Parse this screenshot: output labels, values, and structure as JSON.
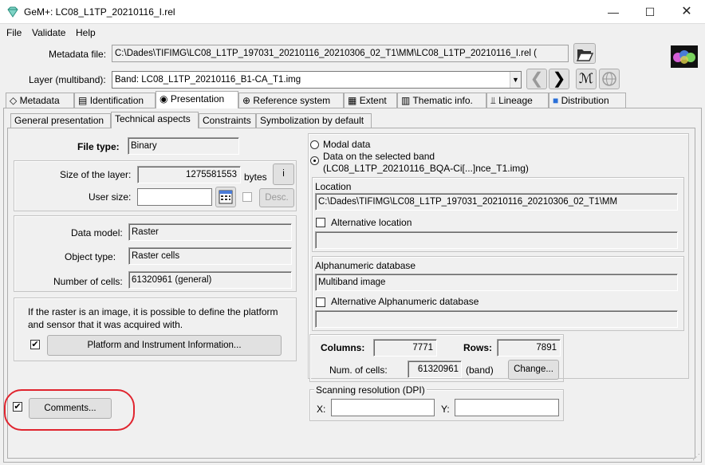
{
  "window": {
    "title": "GeM+: LC08_L1TP_20210116_I.rel",
    "controls": [
      "minimize",
      "maximize",
      "close"
    ]
  },
  "menu": [
    "File",
    "Validate",
    "Help"
  ],
  "header": {
    "metadata_label": "Metadata file:",
    "metadata_value": "C:\\Dades\\TIFIMG\\LC08_L1TP_197031_20210116_20210306_02_T1\\MM\\LC08_L1TP_20210116_I.rel (",
    "layer_label": "Layer (multiband):",
    "layer_value": "Band: LC08_L1TP_20210116_B1-CA_T1.img"
  },
  "tabs": [
    {
      "label": "Metadata",
      "icon": "tag-icon"
    },
    {
      "label": "Identification",
      "icon": "id-card-icon"
    },
    {
      "label": "Presentation",
      "icon": "eye-icon",
      "active": true
    },
    {
      "label": "Reference system",
      "icon": "globe-icon"
    },
    {
      "label": "Extent",
      "icon": "map-icon"
    },
    {
      "label": "Thematic info.",
      "icon": "table-icon"
    },
    {
      "label": "Lineage",
      "icon": "tree-icon"
    },
    {
      "label": "Distribution",
      "icon": "truck-icon"
    }
  ],
  "subtabs": [
    {
      "label": "General presentation"
    },
    {
      "label": "Technical aspects",
      "active": true
    },
    {
      "label": "Constraints"
    },
    {
      "label": "Symbolization by default"
    }
  ],
  "left": {
    "file_type_label": "File type:",
    "file_type_value": "Binary",
    "size_label": "Size of the layer:",
    "size_value": "1275581553",
    "size_unit": "bytes",
    "info_button": "i",
    "user_size_label": "User size:",
    "user_size_value": "",
    "desc_button": "Desc.",
    "data_model_label": "Data model:",
    "data_model_value": "Raster",
    "object_type_label": "Object type:",
    "object_type_value": "Raster cells",
    "num_cells_label": "Number of cells:",
    "num_cells_value": "61320961 (general)",
    "platform_text": "If the raster is an image, it is possible to define the platform and sensor that it was acquired with.",
    "platform_button": "Platform and Instrument Information...",
    "platform_checked": true,
    "comments_button": "Comments...",
    "comments_checked": true
  },
  "right": {
    "modal_label": "Modal data",
    "selected_band_label": "Data on the selected band",
    "selected_band_sub": "(LC08_L1TP_20210116_BQA-Ci[...]nce_T1.img)",
    "location_title": "Location",
    "location_value": "C:\\Dades\\TIFIMG\\LC08_L1TP_197031_20210116_20210306_02_T1\\MM",
    "alt_location_label": "Alternative location",
    "alt_location_value": "",
    "alnum_title": "Alphanumeric database",
    "alnum_value": "Multiband image",
    "alt_alnum_label": "Alternative Alphanumeric database",
    "alt_alnum_value": "",
    "columns_label": "Columns:",
    "columns_value": "7771",
    "rows_label": "Rows:",
    "rows_value": "7891",
    "num_cells_label": "Num. of cells:",
    "num_cells_value": "61320961",
    "num_cells_unit": "(band)",
    "change_button": "Change...",
    "dpi_title": "Scanning resolution (DPI)",
    "x_label": "X:",
    "x_value": "",
    "y_label": "Y:",
    "y_value": ""
  },
  "highlight_color": "#e0242e"
}
